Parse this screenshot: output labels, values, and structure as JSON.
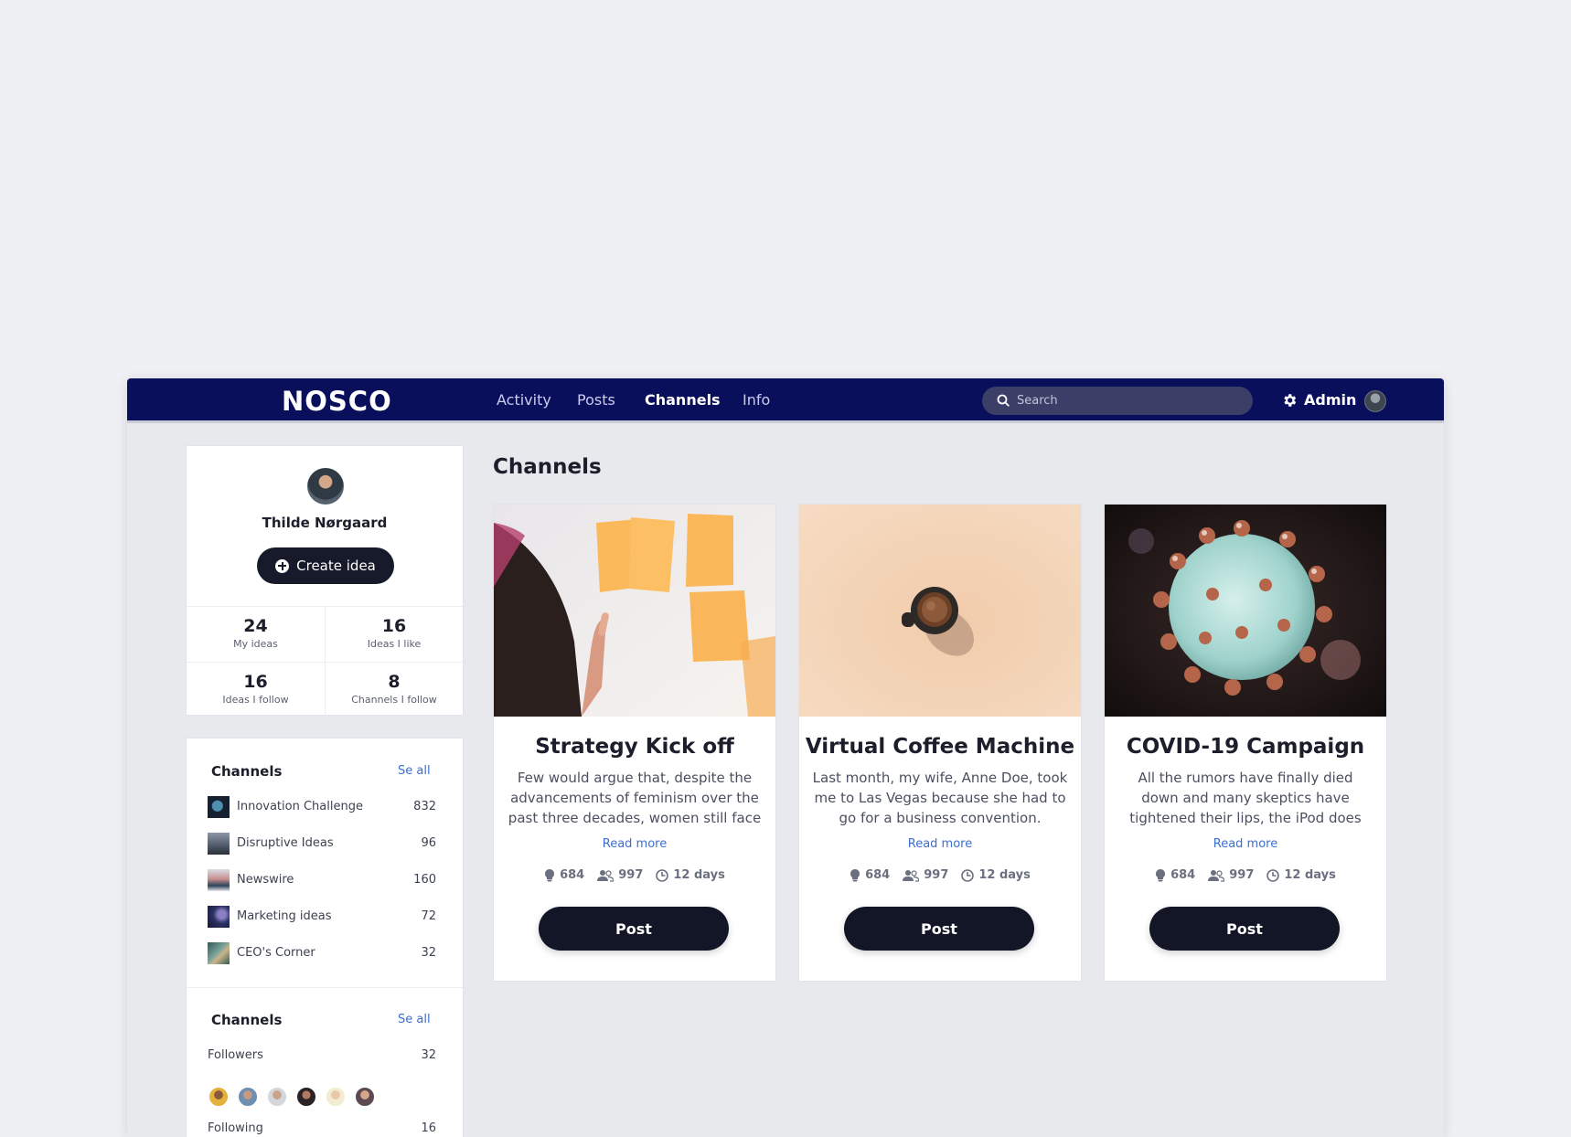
{
  "header": {
    "logo": "NOSCO",
    "nav": [
      {
        "label": "Activity"
      },
      {
        "label": "Posts"
      },
      {
        "label": "Channels"
      },
      {
        "label": "Info"
      }
    ],
    "search_placeholder": "Search",
    "admin_label": "Admin"
  },
  "profile": {
    "name": "Thilde Nørgaard",
    "create_label": "Create idea",
    "stats": [
      {
        "value": "24",
        "label": "My ideas"
      },
      {
        "value": "16",
        "label": "Ideas I like"
      },
      {
        "value": "16",
        "label": "Ideas I follow"
      },
      {
        "value": "8",
        "label": "Channels I follow"
      }
    ]
  },
  "channels_panel": {
    "title": "Channels",
    "see_all": "Se all",
    "items": [
      {
        "name": "Innovation Challenge",
        "count": "832"
      },
      {
        "name": "Disruptive Ideas",
        "count": "96"
      },
      {
        "name": "Newswire",
        "count": "160"
      },
      {
        "name": "Marketing ideas",
        "count": "72"
      },
      {
        "name": "CEO's Corner",
        "count": "32"
      }
    ]
  },
  "social_panel": {
    "title": "Channels",
    "see_all": "Se all",
    "followers_label": "Followers",
    "followers_count": "32",
    "following_label": "Following",
    "following_count": "16"
  },
  "main": {
    "title": "Channels",
    "cards": [
      {
        "title": "Strategy Kick off",
        "desc": "Few would argue that, despite the advancements of feminism over the past three decades, women still face a double standard when it comes to their behavior.",
        "read_more": "Read more",
        "ideas": "684",
        "members": "997",
        "age": "12 days",
        "button": "Post"
      },
      {
        "title": "Virtual Coffee Machine",
        "desc": "Last month, my wife, Anne Doe, took me to Las Vegas because she had to go for a business convention.",
        "read_more": "Read more",
        "ideas": "684",
        "members": "997",
        "age": "12 days",
        "button": "Post"
      },
      {
        "title": "COVID-19 Campaign",
        "desc": "All the rumors have finally died down and many skeptics have tightened their lips, the iPod does support video format now on its fifth generation.",
        "read_more": "Read more",
        "ideas": "684",
        "members": "997",
        "age": "12 days",
        "button": "Post"
      }
    ]
  }
}
